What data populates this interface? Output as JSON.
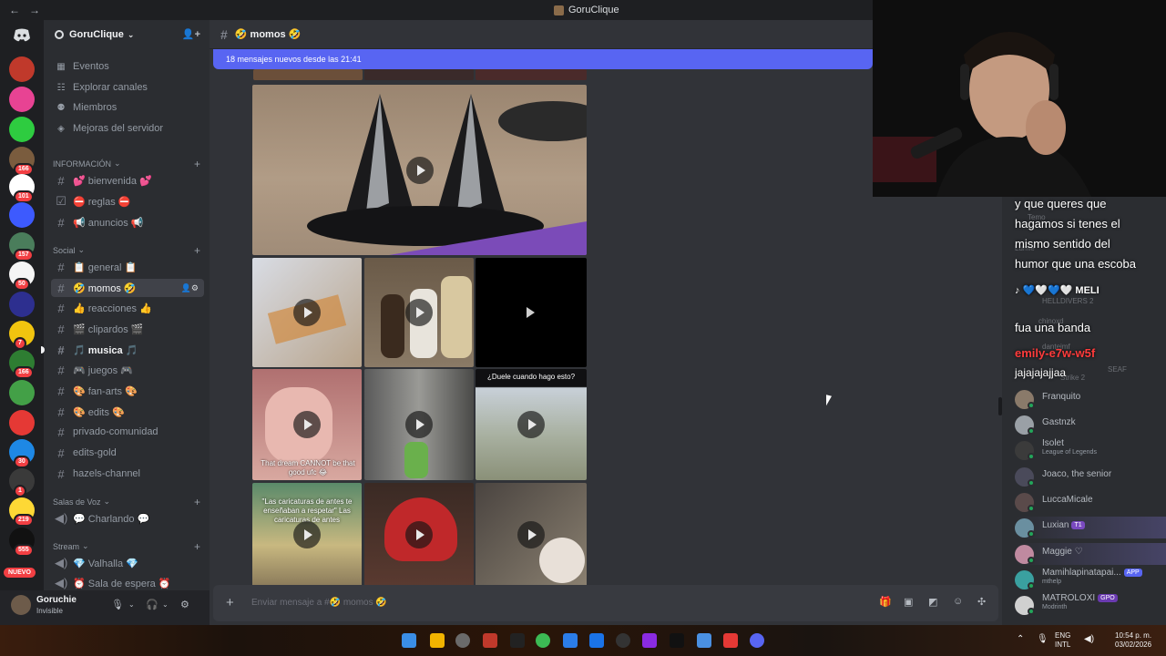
{
  "window": {
    "title": "GoruClique",
    "nav_back": "←",
    "nav_forward": "→"
  },
  "rail": {
    "home_icon": "discord-icon",
    "servers": [
      {
        "name": "server-1",
        "color": "#c0392b",
        "badge": ""
      },
      {
        "name": "server-2",
        "color": "#e84393",
        "badge": ""
      },
      {
        "name": "server-3",
        "color": "#2ecc40",
        "badge": ""
      },
      {
        "name": "server-4",
        "color": "#7a5c3e",
        "badge": "166"
      },
      {
        "name": "server-5",
        "color": "#ffffff",
        "badge": "101"
      },
      {
        "name": "server-6",
        "color": "#3d5afe",
        "badge": ""
      },
      {
        "name": "server-7",
        "color": "#4a7d5b",
        "badge": "157"
      },
      {
        "name": "server-8",
        "color": "#f5f5f5",
        "badge": "50"
      },
      {
        "name": "server-9",
        "color": "#2d2f8f",
        "badge": ""
      },
      {
        "name": "server-10",
        "color": "#f1c40f",
        "badge": "7"
      },
      {
        "name": "server-11",
        "color": "#2e7d32",
        "badge": "166"
      },
      {
        "name": "server-12",
        "color": "#43a047",
        "badge": ""
      },
      {
        "name": "server-13",
        "color": "#e53935",
        "badge": ""
      },
      {
        "name": "server-14",
        "color": "#1e88e5",
        "badge": "30"
      },
      {
        "name": "server-15",
        "color": "#3a3a3a",
        "badge": "1"
      },
      {
        "name": "server-16",
        "color": "#fdd835",
        "badge": "219"
      },
      {
        "name": "server-17",
        "color": "#111111",
        "badge": "555"
      }
    ],
    "nuevo_label": "NUEVO"
  },
  "guild": {
    "name": "GoruClique",
    "top_items": [
      {
        "label": "Eventos",
        "icon": "calendar-icon",
        "glyph": "▦"
      },
      {
        "label": "Explorar canales",
        "icon": "browse-icon",
        "glyph": "☷"
      },
      {
        "label": "Miembros",
        "icon": "members-icon",
        "glyph": "👥"
      },
      {
        "label": "Mejoras del servidor",
        "icon": "boost-icon",
        "glyph": "◈"
      }
    ],
    "categories": {
      "informacion": "INFORMACIÓN",
      "social": "Social",
      "voz": "Salas de Voz",
      "stream": "Stream"
    },
    "info_channels": [
      "💕 bienvenida 💕",
      "⛔ reglas ⛔",
      "📢 anuncios 📢"
    ],
    "social_channels": [
      "📋 general 📋",
      "🤣 momos 🤣",
      "👍 reacciones 👍",
      "🎬 clipardos 🎬",
      "🎵 musica 🎵",
      "🎮 juegos 🎮",
      "🎨 fan-arts 🎨",
      "🎨 edits 🎨",
      "privado-comunidad",
      "edits-gold",
      "hazels-channel"
    ],
    "voice_channels": [
      "💬 Charlando 💬"
    ],
    "stream_channels": [
      "💎 Valhalla 💎",
      "⏰ Sala de espera ⏰"
    ]
  },
  "user": {
    "name": "Goruchie",
    "status": "Invisible"
  },
  "chat": {
    "channel": "🤣 momos 🤣",
    "new_messages": "18 mensajes nuevos desde las 21:41",
    "captions": {
      "tile8_top": "¿Duele cuando hago esto?",
      "tile7_bottom": "That dream CANNOT be that good ufc 😂",
      "tile10_mid": "\"Las caricaturas de antes te enseñaban a respetar\"  Las caricaturas de antes"
    },
    "composer_placeholder": "Enviar mensaje a #🤣 momos 🤣"
  },
  "overlay": {
    "lines": [
      "y que queres que",
      "hagamos si tenes el",
      "mismo sentido del",
      "humor que una escoba",
      "💙🤍💙🤍 MELI",
      "fua una banda",
      "emily-e7w-w5f",
      "jajajajajjaa"
    ],
    "ghosts": [
      "Temo",
      "Lumie",
      "HELLDIVERS 2",
      "chinoxd",
      "dantejmf",
      "Strike 2",
      "SEAF"
    ]
  },
  "members": [
    {
      "name": "Franquito",
      "sub": "",
      "tag": "",
      "tag_color": "",
      "color": "#8a7a6a"
    },
    {
      "name": "Gastnzk",
      "sub": "",
      "tag": "",
      "tag_color": "",
      "color": "#9aa0a6"
    },
    {
      "name": "Isolet",
      "sub": "League of Legends",
      "tag": "",
      "tag_color": "",
      "color": "#3b3b3b"
    },
    {
      "name": "Joaco, the senior",
      "sub": "",
      "tag": "",
      "tag_color": "",
      "color": "#4a4a5a"
    },
    {
      "name": "LuccaMicale",
      "sub": "",
      "tag": "",
      "tag_color": "",
      "color": "#5a4a4a"
    },
    {
      "name": "Luxian",
      "sub": "",
      "tag": "T1",
      "tag_color": "#7a4ac0",
      "color": "#6a8fa0"
    },
    {
      "name": "Maggie ♡",
      "sub": "",
      "tag": "",
      "tag_color": "",
      "color": "#c08aa0"
    },
    {
      "name": "Mamihlapinatapai...",
      "sub": "mthelp",
      "tag": "APP",
      "tag_color": "#5865f2",
      "color": "#3aa0a0"
    },
    {
      "name": "MATROLOXI",
      "sub": "Modrinth",
      "tag": "GPO",
      "tag_color": "#6a3ab0",
      "color": "#d0d0d0"
    }
  ],
  "taskbar": {
    "lang": "ENG",
    "layout": "INTL",
    "time": "10:54 p. m.",
    "date": "03/02/2026"
  },
  "colors": {
    "accent": "#5865f2",
    "online": "#23a55a",
    "badge": "#f23f43"
  }
}
